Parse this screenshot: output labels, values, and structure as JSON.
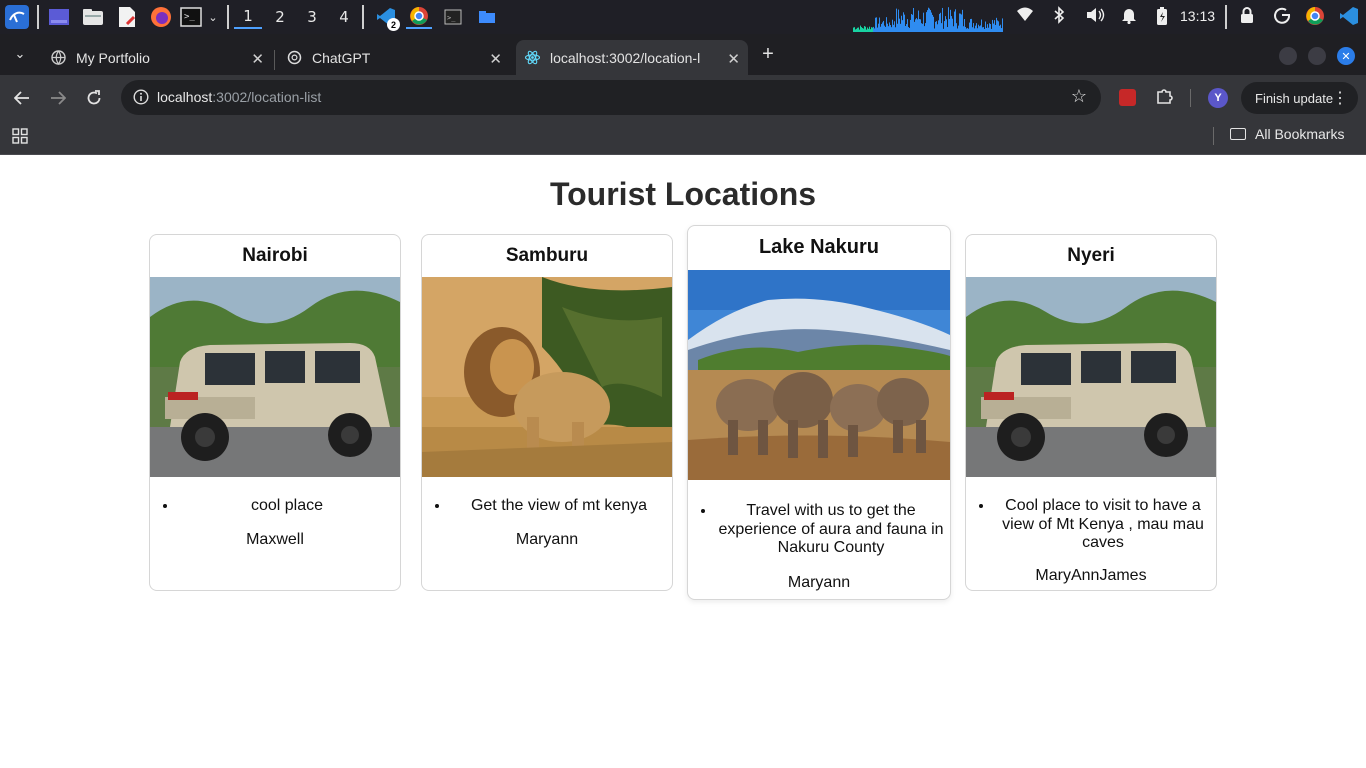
{
  "taskbar": {
    "workspaces": [
      "1",
      "2",
      "3",
      "4"
    ],
    "vscode_badge": "2",
    "clock": "13:13"
  },
  "tabs": [
    {
      "title": "My Portfolio",
      "icon": "globe-icon"
    },
    {
      "title": "ChatGPT",
      "icon": "openai-icon"
    },
    {
      "title": "localhost:3002/location-l",
      "icon": "react-icon"
    }
  ],
  "toolbar": {
    "url_host": "localhost",
    "url_rest": ":3002/location-list",
    "finish_update_label": "Finish update",
    "avatar_letter": "Y"
  },
  "bookmarks": {
    "all_bookmarks_label": "All Bookmarks"
  },
  "page": {
    "title": "Tourist Locations",
    "cards": [
      {
        "name": "Nairobi",
        "image": "safari-jeep",
        "description": "cool place",
        "author": "Maxwell"
      },
      {
        "name": "Samburu",
        "image": "lion",
        "description": "Get the view of mt kenya",
        "author": "Maryann"
      },
      {
        "name": "Lake Nakuru",
        "image": "elephants-kilimanjaro",
        "description": "Travel with us to get the experience of aura and fauna in Nakuru County",
        "author": "Maryann"
      },
      {
        "name": "Nyeri",
        "image": "safari-jeep",
        "description": "Cool place to visit to have a view of Mt Kenya , mau mau caves",
        "author": "MaryAnnJames"
      }
    ]
  }
}
